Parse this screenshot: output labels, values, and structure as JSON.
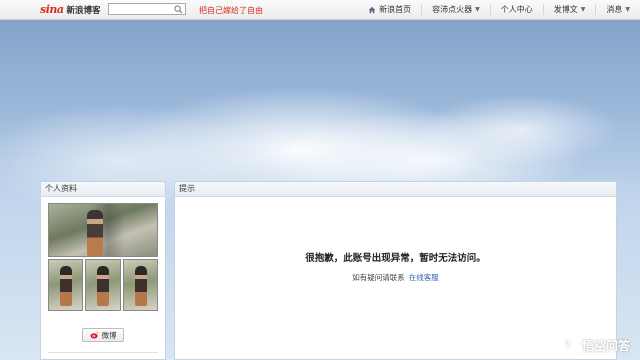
{
  "topbar": {
    "logo_mark": "sina",
    "logo_text": "新浪博客",
    "search": {
      "value": "",
      "placeholder": ""
    },
    "blog_link": "把自己嫁给了自由",
    "nav": [
      {
        "label": "新浪首页",
        "icon": "home-icon"
      },
      {
        "label": "容沛点火器",
        "has_caret": true
      },
      {
        "label": "个人中心"
      },
      {
        "label": "发博文",
        "has_caret": true
      },
      {
        "label": "消息",
        "has_caret": true
      }
    ]
  },
  "sidebar": {
    "title": "个人资料",
    "weibo_label": "微博"
  },
  "main": {
    "title": "提示",
    "message": "很抱歉，此账号出现异常，暂时无法访问。",
    "contact_text": "如有疑问请联系",
    "contact_link": "在线客服"
  },
  "watermark": {
    "text": "悟空问答"
  },
  "colors": {
    "brand_red": "#d62d20",
    "link_blue": "#2c6ab0"
  }
}
